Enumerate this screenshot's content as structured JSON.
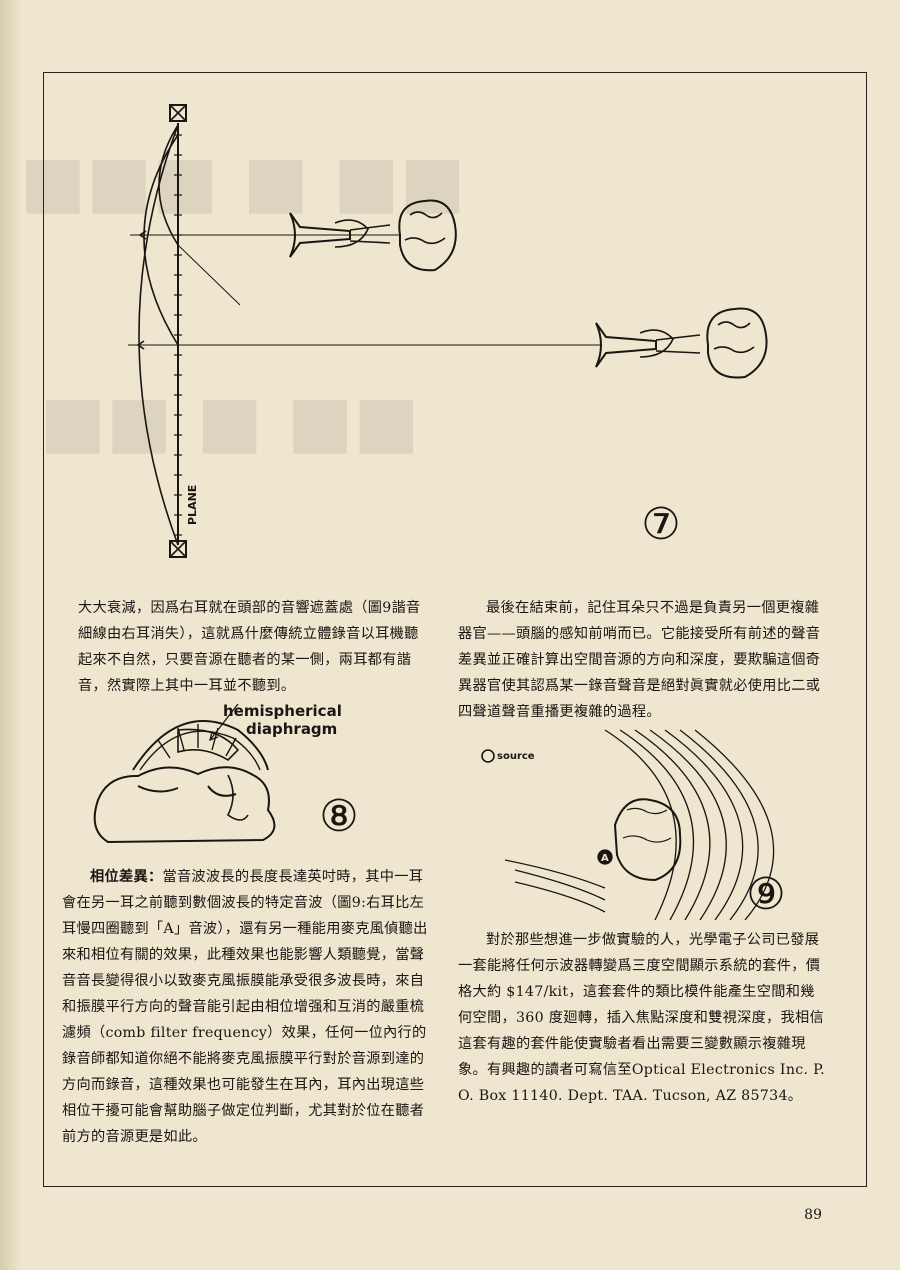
{
  "figure7": {
    "plane_label": "PLANE",
    "number": "⑦"
  },
  "figure8": {
    "label_line1": "hemispherical",
    "label_line2": "diaphragm",
    "number": "⑧"
  },
  "figure9": {
    "source_label": "source",
    "marker_label": "A",
    "number": "⑨"
  },
  "left_column": {
    "paragraph1": "大大衰減，因爲右耳就在頭部的音響遮蓋處（圖9諧音細線由右耳消失），這就爲什麼傳統立體錄音以耳機聽起來不自然，只要音源在聽者的某一側，兩耳都有諧音，然實際上其中一耳並不聽到。",
    "paragraph2_lead": "相位差異：",
    "paragraph2": "當音波波長的長度長達英吋時，其中一耳會在另一耳之前聽到數個波長的特定音波（圖9:右耳比左耳慢四圈聽到「A」音波），還有另一種能用麥克風偵聽出來和相位有關的效果，此種效果也能影響人類聽覺，當聲音音長變得很小以致麥克風振膜能承受很多波長時，來自和振膜平行方向的聲音能引起由相位增强和互消的嚴重梳濾頻（comb filter frequency）效果，任何一位內行的錄音師都知道你絕不能將麥克風振膜平行對於音源到達的方向而錄音，這種效果也可能發生在耳內，耳內出現這些相位干擾可能會幫助腦子做定位判斷，尤其對於位在聽者前方的音源更是如此。"
  },
  "right_column": {
    "paragraph1": "最後在結束前，記住耳朵只不過是負責另一個更複雜器官——頭腦的感知前哨而已。它能接受所有前述的聲音差異並正確計算出空間音源的方向和深度，要欺騙這個奇異器官使其認爲某一錄音聲音是絕對眞實就必使用比二或四聲道聲音重播更複雜的過程。",
    "paragraph2": "對於那些想進一步做實驗的人，光學電子公司已發展一套能將任何示波器轉變爲三度空間顯示系統的套件，價格大約 $147/kit，這套套件的類比模件能產生空間和幾何空間，360 度廻轉，插入焦點深度和雙視深度，我相信這套有趣的套件能使實驗者看出需要三變數顯示複雜現象。有興趣的讀者可寫信至Optical Electronics Inc. P. O. Box 11140. Dept. TAA. Tucson, AZ 85734。"
  },
  "page_number": "89"
}
